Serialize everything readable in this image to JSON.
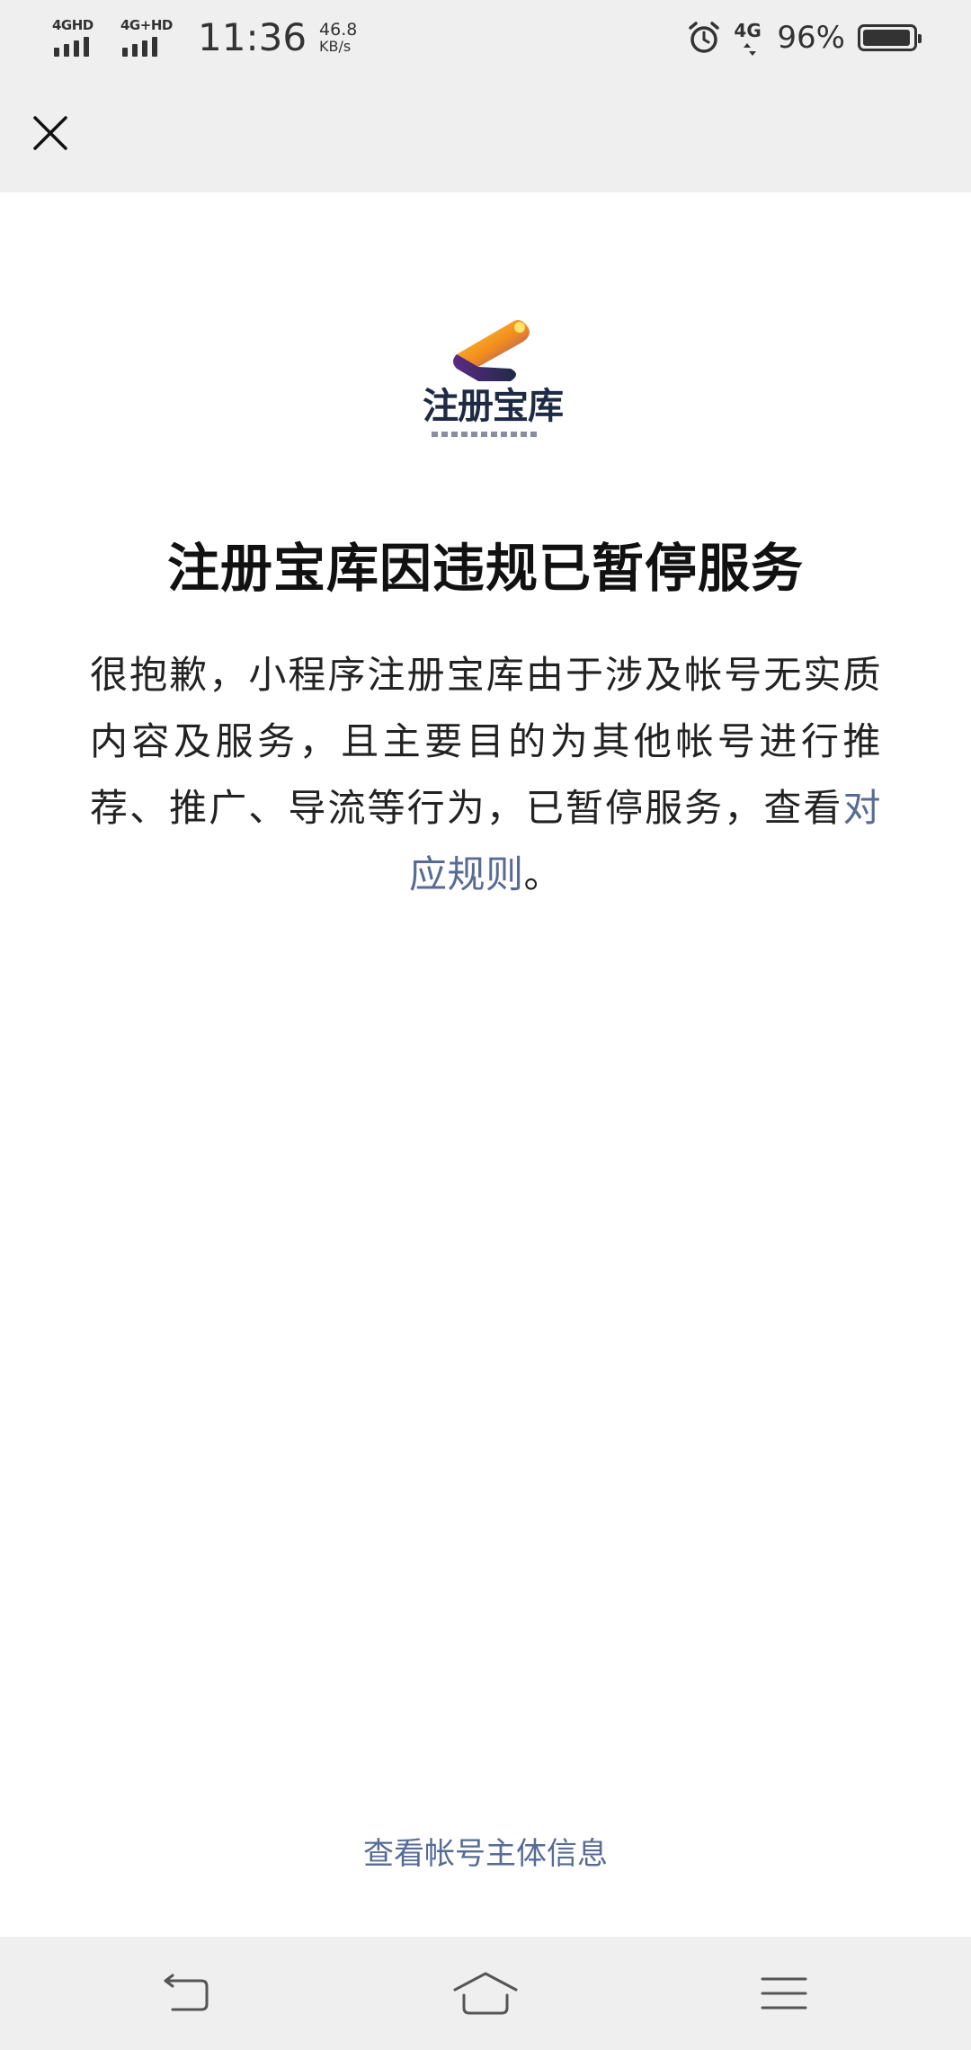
{
  "status_bar": {
    "sim1_label": "4GHD",
    "sim2_label": "4G+HD",
    "time": "11:36",
    "speed_value": "46.8",
    "speed_unit": "KB/s",
    "network_label": "4G",
    "battery_text": "96%",
    "battery_level": 0.96,
    "icons": [
      "signal-icon",
      "alarm-icon",
      "network-4g-icon",
      "battery-icon"
    ]
  },
  "nav": {
    "close_icon": "close-icon"
  },
  "logo": {
    "brand_text": "注册宝库"
  },
  "main": {
    "title": "注册宝库因违规已暂停服务",
    "description_prefix": "很抱歉，小程序注册宝库由于涉及帐号无实质内容及服务，且主要目的为其他帐号进行推荐、推广、导流等行为，已暂停服务，查看",
    "rule_link_text": "对应规则",
    "description_suffix": "。",
    "account_info_link": "查看帐号主体信息"
  },
  "system_nav": {
    "back_icon": "back-icon",
    "home_icon": "home-icon",
    "menu_icon": "menu-icon"
  },
  "colors": {
    "link": "#576b95",
    "bar_background": "#efefef",
    "logo_dark": "#1f2a44",
    "logo_orange": "#f5a623",
    "logo_purple": "#7b3fa0"
  }
}
